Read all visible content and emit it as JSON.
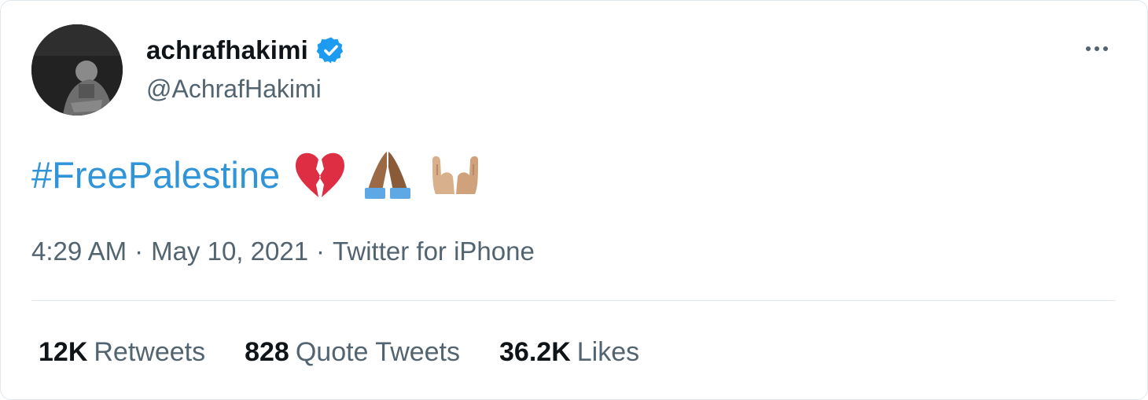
{
  "author": {
    "display_name": "achrafhakimi",
    "handle": "@AchrafHakimi",
    "verified": true
  },
  "tweet": {
    "hashtag": "#FreePalestine",
    "emojis": [
      "broken-heart",
      "folded-hands-medium-dark",
      "palms-up-together-medium-light"
    ]
  },
  "meta": {
    "time": "4:29 AM",
    "separator": "·",
    "date": "May 10, 2021",
    "source": "Twitter for iPhone"
  },
  "stats": {
    "retweets_count": "12K",
    "retweets_label": "Retweets",
    "quotes_count": "828",
    "quotes_label": "Quote Tweets",
    "likes_count": "36.2K",
    "likes_label": "Likes"
  },
  "colors": {
    "link": "#2f95d8",
    "verified": "#1d9bf0",
    "muted": "#536471"
  }
}
